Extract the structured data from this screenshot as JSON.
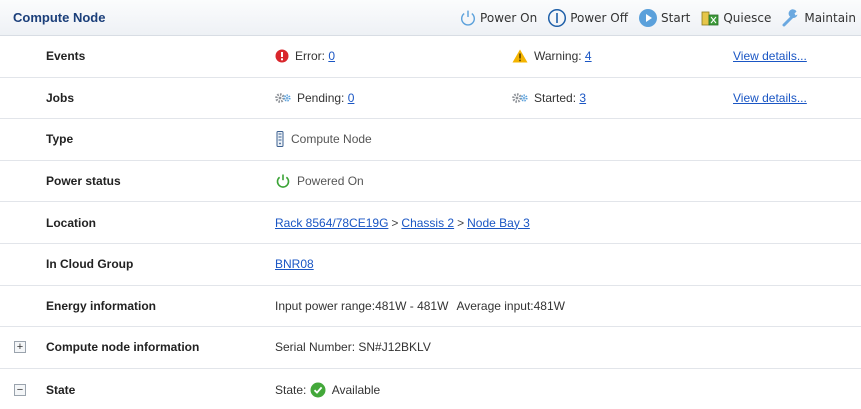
{
  "header": {
    "title": "Compute Node",
    "toolbar": {
      "power_on": "Power On",
      "power_off": "Power Off",
      "start": "Start",
      "quiesce": "Quiesce",
      "maintain": "Maintain"
    }
  },
  "rows": {
    "events": {
      "label": "Events",
      "error_label": "Error:",
      "error_count": "0",
      "warning_label": "Warning:",
      "warning_count": "4",
      "details": "View details..."
    },
    "jobs": {
      "label": "Jobs",
      "pending_label": "Pending:",
      "pending_count": "0",
      "started_label": "Started:",
      "started_count": "3",
      "details": "View details..."
    },
    "type": {
      "label": "Type",
      "value": "Compute Node"
    },
    "power_status": {
      "label": "Power status",
      "value": "Powered On"
    },
    "location": {
      "label": "Location",
      "rack": "Rack 8564/78CE19G",
      "separator": ">",
      "chassis": "Chassis 2",
      "bay": "Node Bay 3"
    },
    "cloud_group": {
      "label": "In Cloud Group",
      "value": "BNR08"
    },
    "energy": {
      "label": "Energy information",
      "power_range": "Input power range:481W - 481W",
      "average": "Average input:481W"
    },
    "compute_info": {
      "label": "Compute node information",
      "expander": "+",
      "serial": "Serial Number: SN#J12BKLV"
    },
    "state": {
      "label": "State",
      "expander": "−",
      "state_label": "State:",
      "state_value": "Available"
    }
  },
  "colors": {
    "title": "#1b3f7a",
    "link": "#1a56c4",
    "error": "#d9262c",
    "warning": "#f4b400",
    "power_on": "#3aa335",
    "available": "#43a83a",
    "power_icon_blue": "#1e5fa8",
    "start_icon": "#5aa0db"
  },
  "icons": {
    "power_on": "power-icon",
    "power_off": "power-off-icon",
    "start": "play-icon",
    "quiesce": "quiesce-icon",
    "maintain": "wrench-icon",
    "error": "error-icon",
    "warning": "warning-icon",
    "gear": "gears-icon",
    "server": "server-icon",
    "available": "check-icon"
  }
}
